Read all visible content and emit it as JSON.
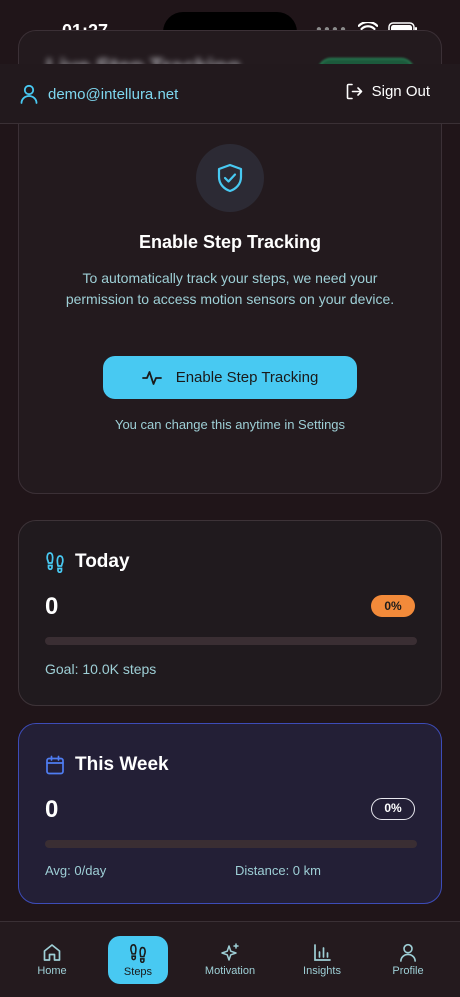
{
  "status_bar": {
    "time": "01:27"
  },
  "page": {
    "title_obscured": "Live Step Tracking"
  },
  "user": {
    "email": "demo@intellura.net",
    "sign_out_label": "Sign Out"
  },
  "permission": {
    "title": "Enable Step Tracking",
    "description": "To automatically track your steps, we need your permission to access motion sensors on your device.",
    "button_label": "Enable Step Tracking",
    "note": "You can change this anytime in Settings"
  },
  "today": {
    "title": "Today",
    "steps": "0",
    "percent": "0%",
    "progress": 0,
    "goal": "Goal: 10.0K steps"
  },
  "week": {
    "title": "This Week",
    "steps": "0",
    "percent": "0%",
    "progress": 0,
    "avg": "Avg: 0/day",
    "distance": "Distance: 0 km"
  },
  "nav": {
    "items": [
      {
        "label": "Home",
        "icon": "home-icon"
      },
      {
        "label": "Steps",
        "icon": "footprints-icon",
        "active": true
      },
      {
        "label": "Motivation",
        "icon": "sparkles-icon"
      },
      {
        "label": "Insights",
        "icon": "bar-chart-icon"
      },
      {
        "label": "Profile",
        "icon": "user-icon"
      }
    ]
  },
  "colors": {
    "accent": "#48c9f2",
    "background": "#201519",
    "badge_orange": "#f28a3a",
    "week_border": "#3d4cb8"
  }
}
